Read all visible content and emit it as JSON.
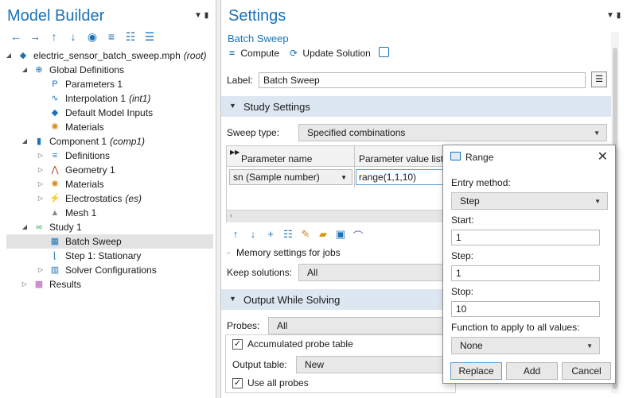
{
  "model_builder": {
    "title": "Model Builder",
    "tree": [
      {
        "label": "electric_sensor_batch_sweep.mph",
        "tag": "(root)",
        "icon": "model-icon",
        "caret": "open",
        "depth": 0
      },
      {
        "label": "Global Definitions",
        "tag": "",
        "icon": "globe-icon",
        "caret": "open",
        "depth": 1
      },
      {
        "label": "Parameters 1",
        "tag": "",
        "icon": "parameters-icon",
        "caret": "",
        "depth": 2
      },
      {
        "label": "Interpolation 1",
        "tag": "(int1)",
        "icon": "interpolation-icon",
        "caret": "",
        "depth": 2
      },
      {
        "label": "Default Model Inputs",
        "tag": "",
        "icon": "model-inputs-icon",
        "caret": "",
        "depth": 2
      },
      {
        "label": "Materials",
        "tag": "",
        "icon": "materials-icon",
        "caret": "",
        "depth": 2
      },
      {
        "label": "Component 1",
        "tag": "(comp1)",
        "icon": "component-icon",
        "caret": "open",
        "depth": 1
      },
      {
        "label": "Definitions",
        "tag": "",
        "icon": "definitions-icon",
        "caret": "closed",
        "depth": 2
      },
      {
        "label": "Geometry 1",
        "tag": "",
        "icon": "geometry-icon",
        "caret": "closed",
        "depth": 2
      },
      {
        "label": "Materials",
        "tag": "",
        "icon": "materials-icon",
        "caret": "closed",
        "depth": 2
      },
      {
        "label": "Electrostatics",
        "tag": "(es)",
        "icon": "electrostatics-icon",
        "caret": "closed",
        "depth": 2
      },
      {
        "label": "Mesh 1",
        "tag": "",
        "icon": "mesh-icon",
        "caret": "",
        "depth": 2
      },
      {
        "label": "Study 1",
        "tag": "",
        "icon": "study-icon",
        "caret": "open",
        "depth": 1
      },
      {
        "label": "Batch Sweep",
        "tag": "",
        "icon": "batch-sweep-icon",
        "caret": "",
        "depth": 2,
        "selected": true
      },
      {
        "label": "Step 1: Stationary",
        "tag": "",
        "icon": "stationary-step-icon",
        "caret": "",
        "depth": 2
      },
      {
        "label": "Solver Configurations",
        "tag": "",
        "icon": "solver-icon",
        "caret": "closed",
        "depth": 2
      },
      {
        "label": "Results",
        "tag": "",
        "icon": "results-icon",
        "caret": "closed",
        "depth": 1
      }
    ]
  },
  "settings": {
    "title": "Settings",
    "subtitle": "Batch Sweep",
    "compute_label": "Compute",
    "update_label": "Update Solution",
    "label_caption": "Label:",
    "label_value": "Batch Sweep",
    "study_settings_header": "Study Settings",
    "sweep_type_caption": "Sweep type:",
    "sweep_type_value": "Specified combinations",
    "param_name_header": "Parameter name",
    "param_value_header": "Parameter value list",
    "param_name_value": "sn (Sample number)",
    "param_value_value": "range(1,1,10)",
    "memory_label": "Memory settings for jobs",
    "keep_solutions_caption": "Keep solutions:",
    "keep_solutions_value": "All",
    "output_header": "Output While Solving",
    "probes_caption": "Probes:",
    "probes_value": "All",
    "accumulated_label": "Accumulated probe table",
    "output_table_caption": "Output table:",
    "output_table_value": "New",
    "use_all_probes_label": "Use all probes"
  },
  "range_dialog": {
    "title": "Range",
    "entry_method_caption": "Entry method:",
    "entry_method_value": "Step",
    "start_caption": "Start:",
    "start_value": "1",
    "step_caption": "Step:",
    "step_value": "1",
    "stop_caption": "Stop:",
    "stop_value": "10",
    "function_caption": "Function to apply to all values:",
    "function_value": "None",
    "replace_label": "Replace",
    "add_label": "Add",
    "cancel_label": "Cancel"
  },
  "colors": {
    "title_blue": "#1a72b8",
    "section_header": "#dde7f1",
    "selection": "#e3e3e3"
  }
}
